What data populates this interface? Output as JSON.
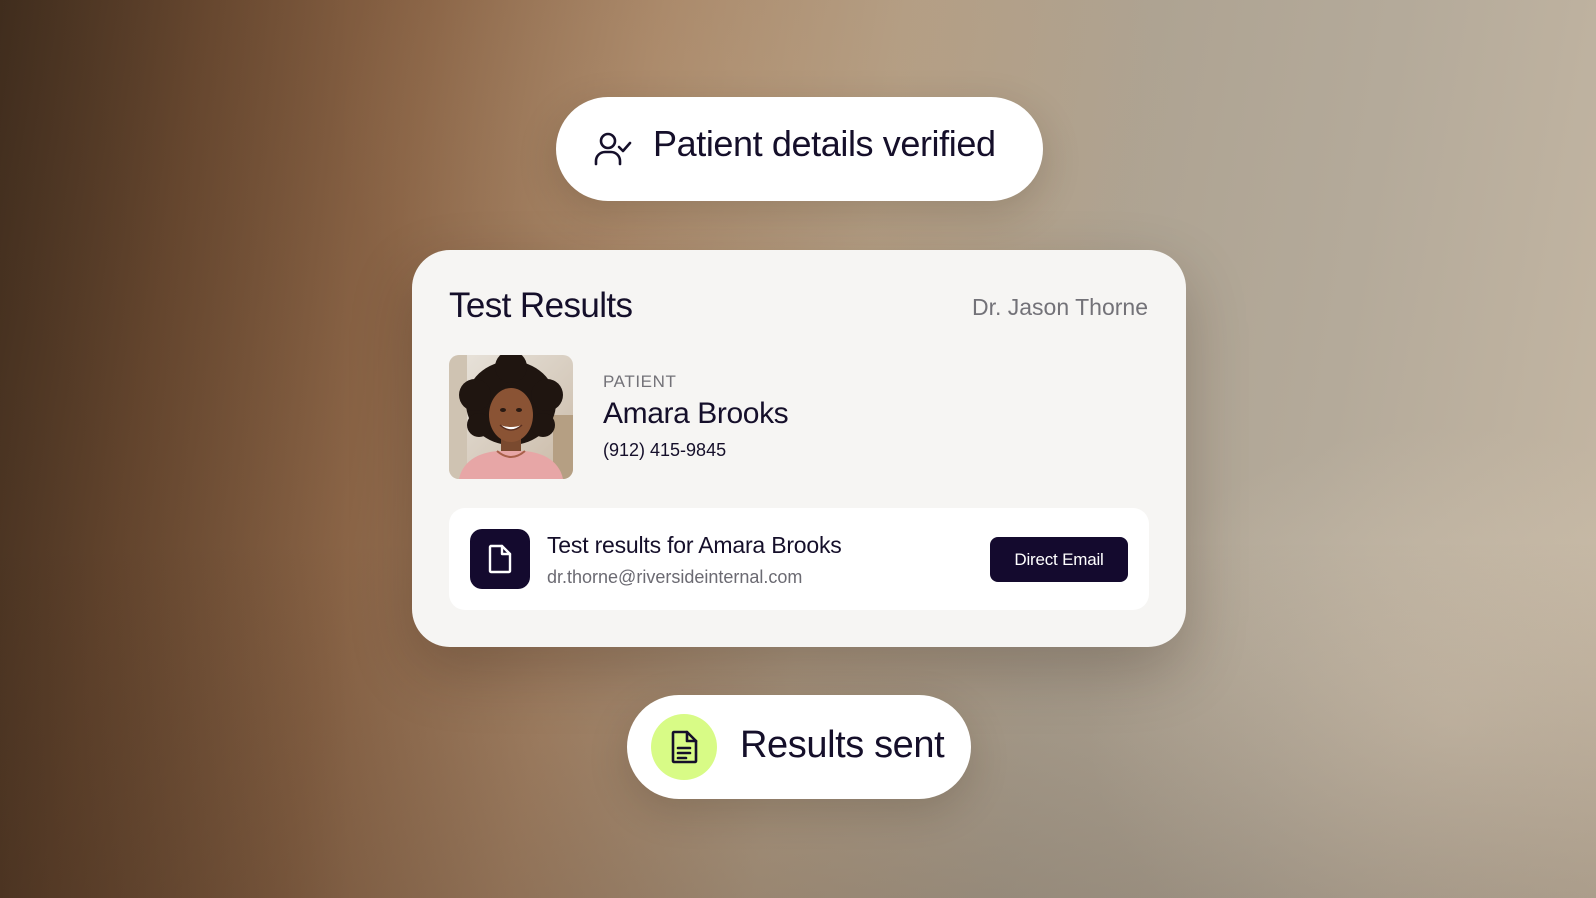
{
  "badges": {
    "verified": {
      "label": "Patient details verified",
      "icon": "user-check-icon"
    },
    "sent": {
      "label": "Results sent",
      "icon": "document-icon",
      "icon_bg_color": "#d8fb86"
    }
  },
  "card": {
    "title": "Test Results",
    "doctor": "Dr. Jason Thorne",
    "patient": {
      "label": "PATIENT",
      "name": "Amara Brooks",
      "phone": "(912) 415-9845",
      "avatar": "patient-photo"
    },
    "result": {
      "title": "Test results for Amara Brooks",
      "email": "dr.thorne@riversideinternal.com",
      "icon": "document-icon",
      "button_label": "Direct Email"
    }
  },
  "colors": {
    "text_primary": "#150f2a",
    "text_muted": "#737278",
    "accent_dark": "#140a2e",
    "accent_lime": "#d8fb86"
  }
}
